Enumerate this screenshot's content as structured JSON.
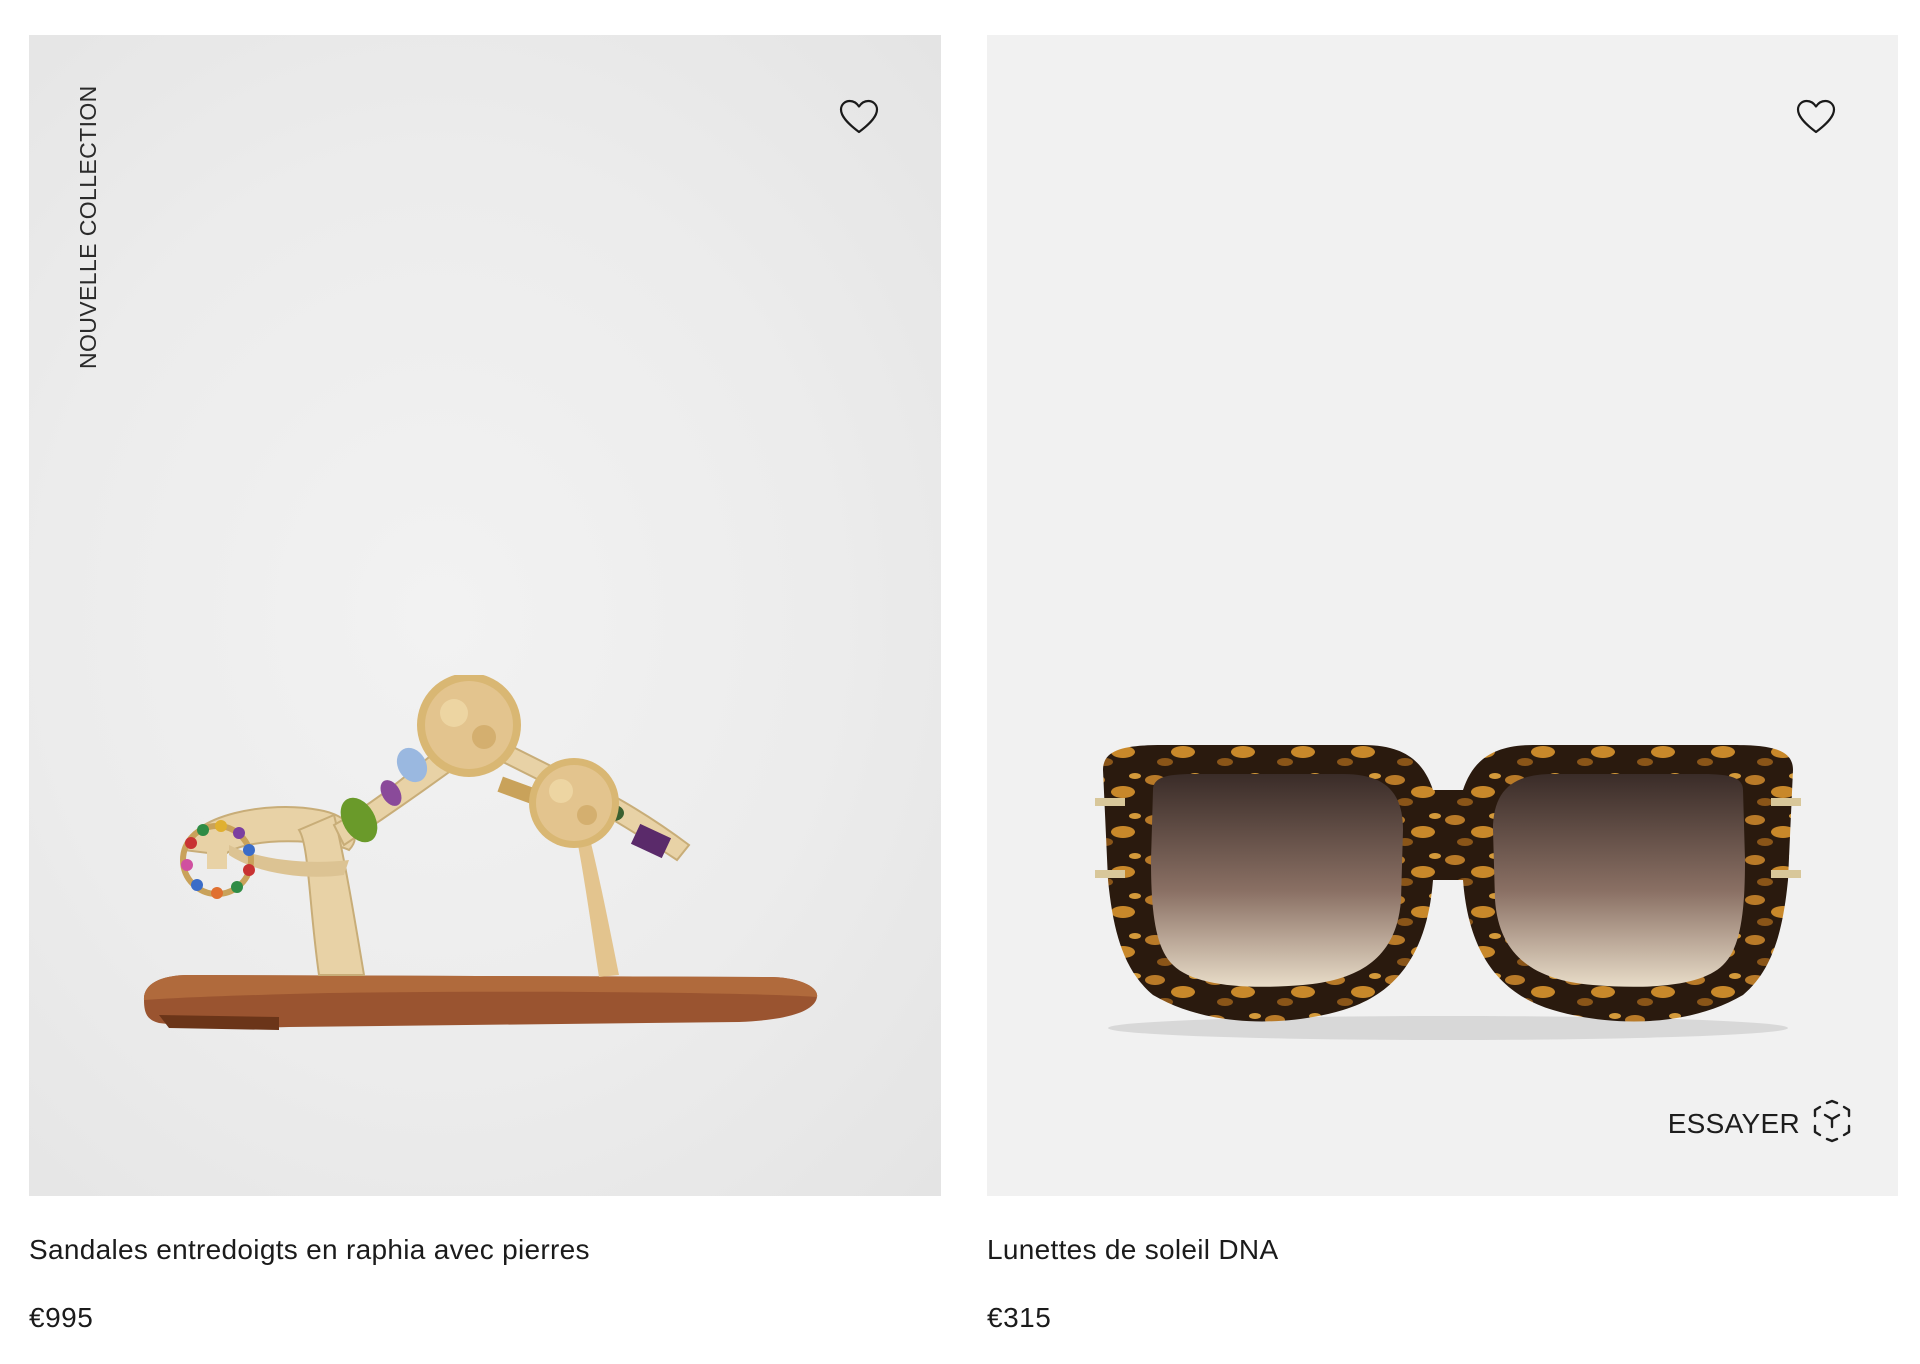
{
  "products": [
    {
      "badge": "NOUVELLE COLLECTION",
      "title": "Sandales entredoigts en raphia avec pierres",
      "price": "€995",
      "image_alt": "sandal",
      "wishlist_icon": "heart-outline-icon"
    },
    {
      "badge": "",
      "title": "Lunettes de soleil DNA",
      "price": "€315",
      "image_alt": "sunglasses",
      "wishlist_icon": "heart-outline-icon",
      "try_on": {
        "label": "ESSAYER",
        "icon": "ar-cube-icon"
      }
    }
  ],
  "colors": {
    "text": "#1b1b1b",
    "panel_bg": "#f1f1f1",
    "sole": "#8b4a2a",
    "raffia": "#e3c48e",
    "tortoise_dark": "#2a1a0e",
    "tortoise_light": "#c8882a"
  }
}
